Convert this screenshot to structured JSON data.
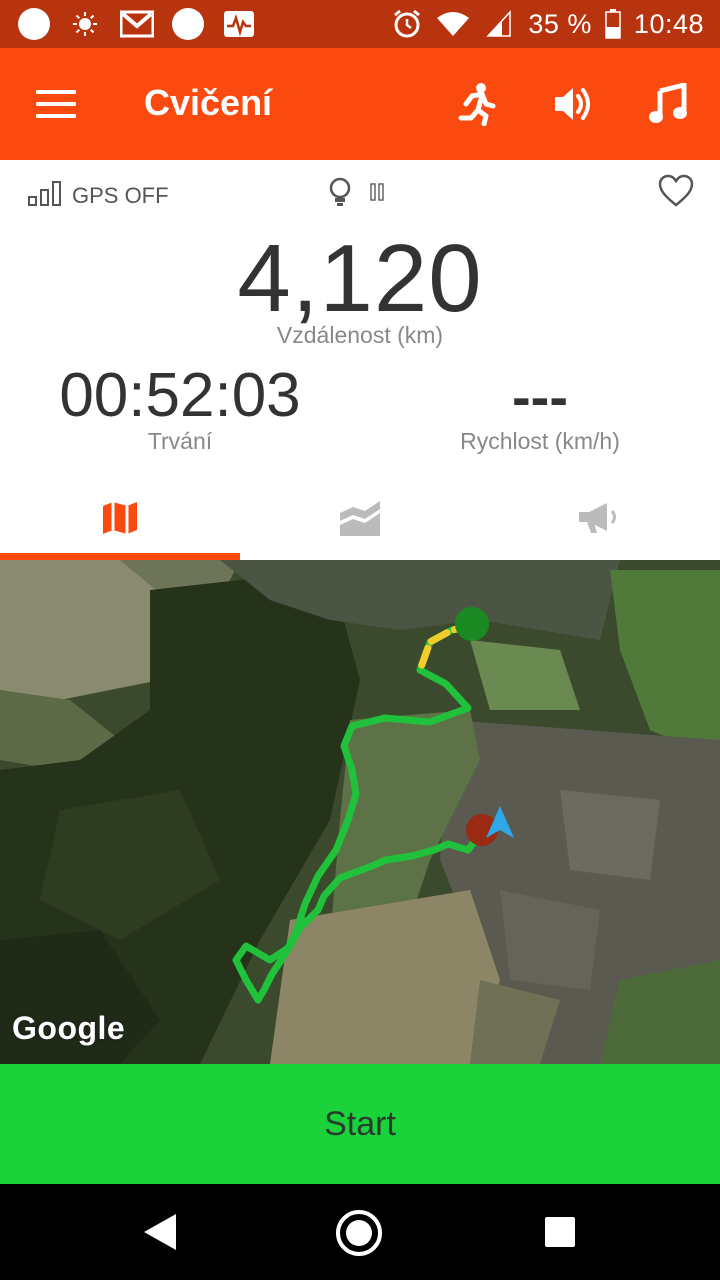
{
  "status_bar": {
    "battery": "35 %",
    "time": "10:48"
  },
  "app_bar": {
    "title": "Cvičení",
    "actions": [
      "run-icon",
      "volume-icon",
      "music-icon"
    ]
  },
  "stats": {
    "gps_status": "GPS OFF",
    "distance_value": "4,120",
    "distance_label": "Vzdálenost (km)",
    "duration_value": "00:52:03",
    "duration_label": "Trvání",
    "speed_value": "---",
    "speed_label": "Rychlost (km/h)"
  },
  "tabs": [
    {
      "icon": "map-icon",
      "active": true
    },
    {
      "icon": "chart-icon",
      "active": false
    },
    {
      "icon": "megaphone-icon",
      "active": false
    }
  ],
  "map": {
    "attribution": "Google"
  },
  "start_button": {
    "label": "Start"
  },
  "colors": {
    "accent": "#fb4a0f",
    "status_bar": "#b8340f",
    "start": "#1ad33a"
  }
}
